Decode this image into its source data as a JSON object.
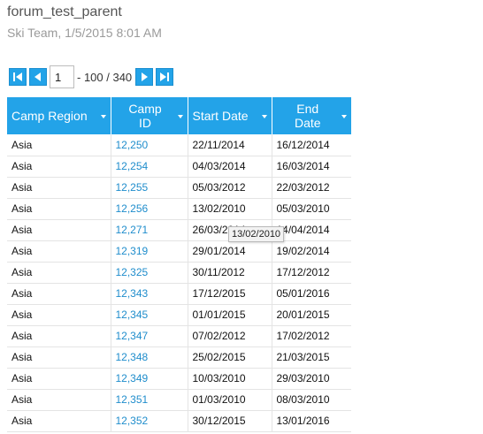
{
  "header": {
    "title": "forum_test_parent",
    "subtitle": "Ski Team, 1/5/2015 8:01 AM"
  },
  "pager": {
    "current_page": "1",
    "range_text": "- 100 / 340",
    "first_icon": "first-page-icon",
    "prev_icon": "prev-page-icon",
    "next_icon": "next-page-icon",
    "last_icon": "last-page-icon"
  },
  "table": {
    "columns": [
      {
        "label": "Camp Region"
      },
      {
        "label": "Camp ID"
      },
      {
        "label": "Start Date"
      },
      {
        "label": "End Date"
      }
    ],
    "rows": [
      {
        "region": "Asia",
        "camp_id": "12,250",
        "start": "22/11/2014",
        "end": "16/12/2014"
      },
      {
        "region": "Asia",
        "camp_id": "12,254",
        "start": "04/03/2014",
        "end": "16/03/2014"
      },
      {
        "region": "Asia",
        "camp_id": "12,255",
        "start": "05/03/2012",
        "end": "22/03/2012"
      },
      {
        "region": "Asia",
        "camp_id": "12,256",
        "start": "13/02/2010",
        "end": "05/03/2010"
      },
      {
        "region": "Asia",
        "camp_id": "12,271",
        "start": "26/03/2014",
        "end": "14/04/2014"
      },
      {
        "region": "Asia",
        "camp_id": "12,319",
        "start": "29/01/2014",
        "end": "19/02/2014"
      },
      {
        "region": "Asia",
        "camp_id": "12,325",
        "start": "30/11/2012",
        "end": "17/12/2012"
      },
      {
        "region": "Asia",
        "camp_id": "12,343",
        "start": "17/12/2015",
        "end": "05/01/2016"
      },
      {
        "region": "Asia",
        "camp_id": "12,345",
        "start": "01/01/2015",
        "end": "20/01/2015"
      },
      {
        "region": "Asia",
        "camp_id": "12,347",
        "start": "07/02/2012",
        "end": "17/02/2012"
      },
      {
        "region": "Asia",
        "camp_id": "12,348",
        "start": "25/02/2015",
        "end": "21/03/2015"
      },
      {
        "region": "Asia",
        "camp_id": "12,349",
        "start": "10/03/2010",
        "end": "29/03/2010"
      },
      {
        "region": "Asia",
        "camp_id": "12,351",
        "start": "01/03/2010",
        "end": "08/03/2010"
      },
      {
        "region": "Asia",
        "camp_id": "12,352",
        "start": "30/12/2015",
        "end": "13/01/2016"
      }
    ]
  },
  "tooltip": {
    "text": "13/02/2010"
  },
  "colors": {
    "header_bg": "#23a3e8",
    "link": "#1f8dcc"
  }
}
